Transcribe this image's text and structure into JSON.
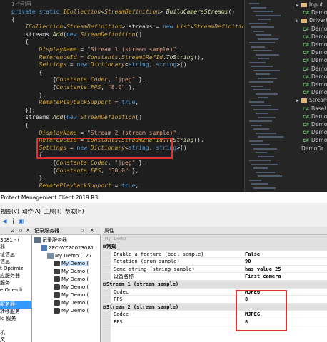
{
  "code": {
    "ref_count": "1 个引用",
    "lines": [
      [
        {
          "c": "kw",
          "t": "private static "
        },
        {
          "c": "it",
          "t": "ICollection"
        },
        {
          "c": "pl",
          "t": "<"
        },
        {
          "c": "it",
          "t": "StreamDefinition"
        },
        {
          "c": "pl",
          "t": "> "
        },
        {
          "c": "mt",
          "t": "BuildCameraStreams"
        },
        {
          "c": "pl",
          "t": "()"
        }
      ],
      [
        {
          "c": "pl",
          "t": "{"
        }
      ],
      [
        {
          "c": "pl",
          "t": "    "
        },
        {
          "c": "it",
          "t": "ICollection"
        },
        {
          "c": "pl",
          "t": "<"
        },
        {
          "c": "it",
          "t": "StreamDefinition"
        },
        {
          "c": "pl",
          "t": "> streams = "
        },
        {
          "c": "kw",
          "t": "new "
        },
        {
          "c": "it",
          "t": "List"
        },
        {
          "c": "pl",
          "t": "<"
        },
        {
          "c": "it",
          "t": "StreamDefinition"
        },
        {
          "c": "pl",
          "t": ">();"
        }
      ],
      [
        {
          "c": "pl",
          "t": "    streams."
        },
        {
          "c": "mt",
          "t": "Add"
        },
        {
          "c": "pl",
          "t": "("
        },
        {
          "c": "kw",
          "t": "new "
        },
        {
          "c": "it",
          "t": "StreamDefinition"
        },
        {
          "c": "pl",
          "t": "()"
        }
      ],
      [
        {
          "c": "pl",
          "t": "    {"
        }
      ],
      [
        {
          "c": "pl",
          "t": "        "
        },
        {
          "c": "pr",
          "t": "DisplayName"
        },
        {
          "c": "pl",
          "t": " = "
        },
        {
          "c": "st",
          "t": "\"Stream 1 (stream sample)\""
        },
        {
          "c": "pl",
          "t": ","
        }
      ],
      [
        {
          "c": "pl",
          "t": "        "
        },
        {
          "c": "pr",
          "t": "ReferenceId"
        },
        {
          "c": "pl",
          "t": " = "
        },
        {
          "c": "it",
          "t": "Constants"
        },
        {
          "c": "pl",
          "t": "."
        },
        {
          "c": "pr",
          "t": "Stream1RefId"
        },
        {
          "c": "pl",
          "t": "."
        },
        {
          "c": "mt",
          "t": "ToString"
        },
        {
          "c": "pl",
          "t": "(),"
        }
      ],
      [
        {
          "c": "pl",
          "t": "        "
        },
        {
          "c": "pr",
          "t": "Settings"
        },
        {
          "c": "pl",
          "t": " = "
        },
        {
          "c": "kw",
          "t": "new "
        },
        {
          "c": "it",
          "t": "Dictionary"
        },
        {
          "c": "pl",
          "t": "<"
        },
        {
          "c": "kw",
          "t": "string"
        },
        {
          "c": "pl",
          "t": ", "
        },
        {
          "c": "kw",
          "t": "string"
        },
        {
          "c": "pl",
          "t": ">()"
        }
      ],
      [
        {
          "c": "pl",
          "t": "        {"
        }
      ],
      [
        {
          "c": "pl",
          "t": "            {"
        },
        {
          "c": "it",
          "t": "Constants"
        },
        {
          "c": "pl",
          "t": "."
        },
        {
          "c": "pr",
          "t": "Codec"
        },
        {
          "c": "pl",
          "t": ", "
        },
        {
          "c": "st",
          "t": "\"jpeg\""
        },
        {
          "c": "pl",
          "t": " },"
        }
      ],
      [
        {
          "c": "pl",
          "t": "            {"
        },
        {
          "c": "it",
          "t": "Constants"
        },
        {
          "c": "pl",
          "t": "."
        },
        {
          "c": "pr",
          "t": "FPS"
        },
        {
          "c": "pl",
          "t": ", "
        },
        {
          "c": "st",
          "t": "\"8.0\""
        },
        {
          "c": "pl",
          "t": " },"
        }
      ],
      [
        {
          "c": "pl",
          "t": "        },"
        }
      ],
      [
        {
          "c": "pl",
          "t": "        "
        },
        {
          "c": "pr",
          "t": "RemotePlaybackSupport"
        },
        {
          "c": "pl",
          "t": " = "
        },
        {
          "c": "kw",
          "t": "true"
        },
        {
          "c": "pl",
          "t": ","
        }
      ],
      [
        {
          "c": "pl",
          "t": "    });"
        }
      ],
      [
        {
          "c": "pl",
          "t": "    streams."
        },
        {
          "c": "mt",
          "t": "Add"
        },
        {
          "c": "pl",
          "t": "("
        },
        {
          "c": "kw",
          "t": "new "
        },
        {
          "c": "it",
          "t": "StreamDefinition"
        },
        {
          "c": "pl",
          "t": "()"
        }
      ],
      [
        {
          "c": "pl",
          "t": "    {"
        }
      ],
      [
        {
          "c": "pl",
          "t": "        "
        },
        {
          "c": "pr",
          "t": "DisplayName"
        },
        {
          "c": "pl",
          "t": " = "
        },
        {
          "c": "st",
          "t": "\"Stream 2 (stream sample)\""
        },
        {
          "c": "pl",
          "t": ","
        }
      ],
      [
        {
          "c": "pl",
          "t": "        "
        },
        {
          "c": "pr",
          "t": "ReferenceId"
        },
        {
          "c": "pl",
          "t": " = "
        },
        {
          "c": "it",
          "t": "Constants"
        },
        {
          "c": "pl",
          "t": "."
        },
        {
          "c": "pr",
          "t": "Stream2RefId"
        },
        {
          "c": "pl",
          "t": "."
        },
        {
          "c": "mt",
          "t": "ToString"
        },
        {
          "c": "pl",
          "t": "(),"
        }
      ],
      [
        {
          "c": "pl",
          "t": "        "
        },
        {
          "c": "pr",
          "t": "Settings"
        },
        {
          "c": "pl",
          "t": " = "
        },
        {
          "c": "kw",
          "t": "new "
        },
        {
          "c": "it",
          "t": "Dictionary"
        },
        {
          "c": "pl",
          "t": "<"
        },
        {
          "c": "kw",
          "t": "string"
        },
        {
          "c": "pl",
          "t": ", "
        },
        {
          "c": "kw",
          "t": "string"
        },
        {
          "c": "pl",
          "t": ">()"
        }
      ],
      [
        {
          "c": "pl",
          "t": "        {"
        }
      ],
      [
        {
          "c": "pl",
          "t": "            {"
        },
        {
          "c": "it",
          "t": "Constants"
        },
        {
          "c": "pl",
          "t": "."
        },
        {
          "c": "pr",
          "t": "Codec"
        },
        {
          "c": "pl",
          "t": ", "
        },
        {
          "c": "st",
          "t": "\"jpeg\""
        },
        {
          "c": "pl",
          "t": " },"
        }
      ],
      [
        {
          "c": "pl",
          "t": "            {"
        },
        {
          "c": "it",
          "t": "Constants"
        },
        {
          "c": "pl",
          "t": "."
        },
        {
          "c": "pr",
          "t": "FPS"
        },
        {
          "c": "pl",
          "t": ", "
        },
        {
          "c": "st",
          "t": "\"30.0\""
        },
        {
          "c": "pl",
          "t": " },"
        }
      ],
      [
        {
          "c": "pl",
          "t": "        },"
        }
      ],
      [
        {
          "c": "pl",
          "t": "        "
        },
        {
          "c": "pr",
          "t": "RemotePlaybackSupport"
        },
        {
          "c": "pl",
          "t": " = "
        },
        {
          "c": "kw",
          "t": "true"
        },
        {
          "c": "pl",
          "t": ","
        }
      ],
      [
        {
          "c": "pl",
          "t": ""
        }
      ],
      [
        {
          "c": "pl",
          "t": "    });"
        }
      ],
      [
        {
          "c": "pl",
          "t": ""
        }
      ],
      [
        {
          "c": "pl",
          "t": "    "
        },
        {
          "c": "kw",
          "t": "return"
        },
        {
          "c": "pl",
          "t": " streams;"
        }
      ]
    ]
  },
  "solution": {
    "items": [
      {
        "type": "folder",
        "label": "Input",
        "indent": 1
      },
      {
        "type": "cs",
        "label": "Demo",
        "indent": 2
      },
      {
        "type": "folder",
        "label": "DriverFa",
        "indent": 1
      },
      {
        "type": "cs",
        "label": "Demo",
        "indent": 2
      },
      {
        "type": "cs",
        "label": "Demo",
        "indent": 2
      },
      {
        "type": "cs",
        "label": "Demo",
        "indent": 2
      },
      {
        "type": "cs",
        "label": "Demo",
        "indent": 2
      },
      {
        "type": "cs",
        "label": "Demo",
        "indent": 2
      },
      {
        "type": "cs",
        "label": "Demo",
        "indent": 2
      },
      {
        "type": "cs",
        "label": "Demo",
        "indent": 2
      },
      {
        "type": "cs",
        "label": "Demo",
        "indent": 2
      },
      {
        "type": "cs",
        "label": "Demo",
        "indent": 2
      },
      {
        "type": "folder",
        "label": "StreamS",
        "indent": 1
      },
      {
        "type": "cs",
        "label": "Basel",
        "indent": 2
      },
      {
        "type": "cs",
        "label": "Demo",
        "indent": 2
      },
      {
        "type": "cs",
        "label": "Demo",
        "indent": 2
      },
      {
        "type": "cs",
        "label": "Demo",
        "indent": 2
      },
      {
        "type": "cs",
        "label": "Demo",
        "indent": 2
      },
      {
        "type": "plain",
        "label": "DemoDr",
        "indent": 1
      }
    ]
  },
  "app": {
    "title": "Protect Management Client 2019 R3",
    "menu": [
      "视图(V)",
      "动作(A)",
      "工具(T)",
      "帮助(H)"
    ],
    "nav_items": [
      "3081 - (",
      "器",
      "证信息",
      "信息",
      "t Optimiz",
      "应服务器",
      "服务",
      "e One-cli",
      "",
      "服务器",
      "转移服务",
      "le 服务",
      "",
      "机",
      "风"
    ],
    "tree_header": "记录服务器",
    "tree": [
      {
        "label": "记录服务器",
        "indent": 0,
        "sel": false
      },
      {
        "label": "ZFC-WZ20023081",
        "indent": 1,
        "sel": false
      },
      {
        "label": "My Demo (127",
        "indent": 2,
        "sel": false
      },
      {
        "label": "My Demo (",
        "indent": 3,
        "sel": true
      },
      {
        "label": "My Demo (",
        "indent": 3,
        "sel": false
      },
      {
        "label": "My Demo (",
        "indent": 3,
        "sel": false
      },
      {
        "label": "My Demo (",
        "indent": 3,
        "sel": false
      },
      {
        "label": "My Demo (",
        "indent": 3,
        "sel": false
      },
      {
        "label": "My Demo (",
        "indent": 3,
        "sel": false
      },
      {
        "label": "My Demo (",
        "indent": 3,
        "sel": false
      }
    ],
    "props_header": "属性",
    "props_title": "My Demo",
    "props": [
      {
        "cat": true,
        "k": "常规",
        "v": ""
      },
      {
        "cat": false,
        "k": "Enable a feature (bool sample)",
        "v": "False"
      },
      {
        "cat": false,
        "k": "Rotation (enum sample)",
        "v": "90"
      },
      {
        "cat": false,
        "k": "Some string (string sample)",
        "v": "has value 25"
      },
      {
        "cat": false,
        "k": "设备名称",
        "v": "First camera"
      },
      {
        "cat": true,
        "k": "Stream 1 (stream sample)",
        "v": ""
      },
      {
        "cat": false,
        "k": "Codec",
        "v": "MJPEG"
      },
      {
        "cat": false,
        "k": "FPS",
        "v": "8"
      },
      {
        "cat": true,
        "k": "Stream 2 (stream sample)",
        "v": ""
      },
      {
        "cat": false,
        "k": "Codec",
        "v": "MJPEG"
      },
      {
        "cat": false,
        "k": "FPS",
        "v": "8"
      }
    ]
  },
  "colors": {
    "highlight": "#e03030",
    "selection": "#3399ff"
  }
}
